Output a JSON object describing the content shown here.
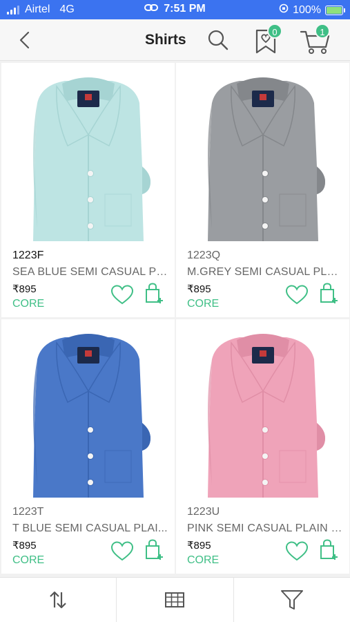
{
  "status_bar": {
    "carrier": "Airtel",
    "network": "4G",
    "time": "7:51 PM",
    "battery": "100%",
    "battery_level": 1.0,
    "accent": "#3b73f0"
  },
  "header": {
    "title": "Shirts",
    "wishlist_count": "0",
    "cart_count": "1",
    "badge_color": "#3fbf86"
  },
  "products": [
    {
      "code": "1223F",
      "name": "SEA BLUE SEMI CASUAL PL...",
      "price": "₹895",
      "tag": "CORE",
      "shirt_color": "#bde4e3",
      "shirt_shade": "#a6d4d3"
    },
    {
      "code": "1223Q",
      "name": "M.GREY SEMI CASUAL PLAI...",
      "price": "₹895",
      "tag": "CORE",
      "shirt_color": "#9a9da1",
      "shirt_shade": "#84878b"
    },
    {
      "code": "1223T",
      "name": "T BLUE SEMI CASUAL PLAI...",
      "price": "₹895",
      "tag": "CORE",
      "shirt_color": "#4a78c8",
      "shirt_shade": "#3a66b3"
    },
    {
      "code": "1223U",
      "name": "PINK SEMI CASUAL PLAIN S...",
      "price": "₹895",
      "tag": "CORE",
      "shirt_color": "#efa3b9",
      "shirt_shade": "#e08ea6"
    }
  ],
  "bottom_bar": {
    "items": [
      "sort-icon",
      "grid-view-icon",
      "filter-icon"
    ]
  }
}
